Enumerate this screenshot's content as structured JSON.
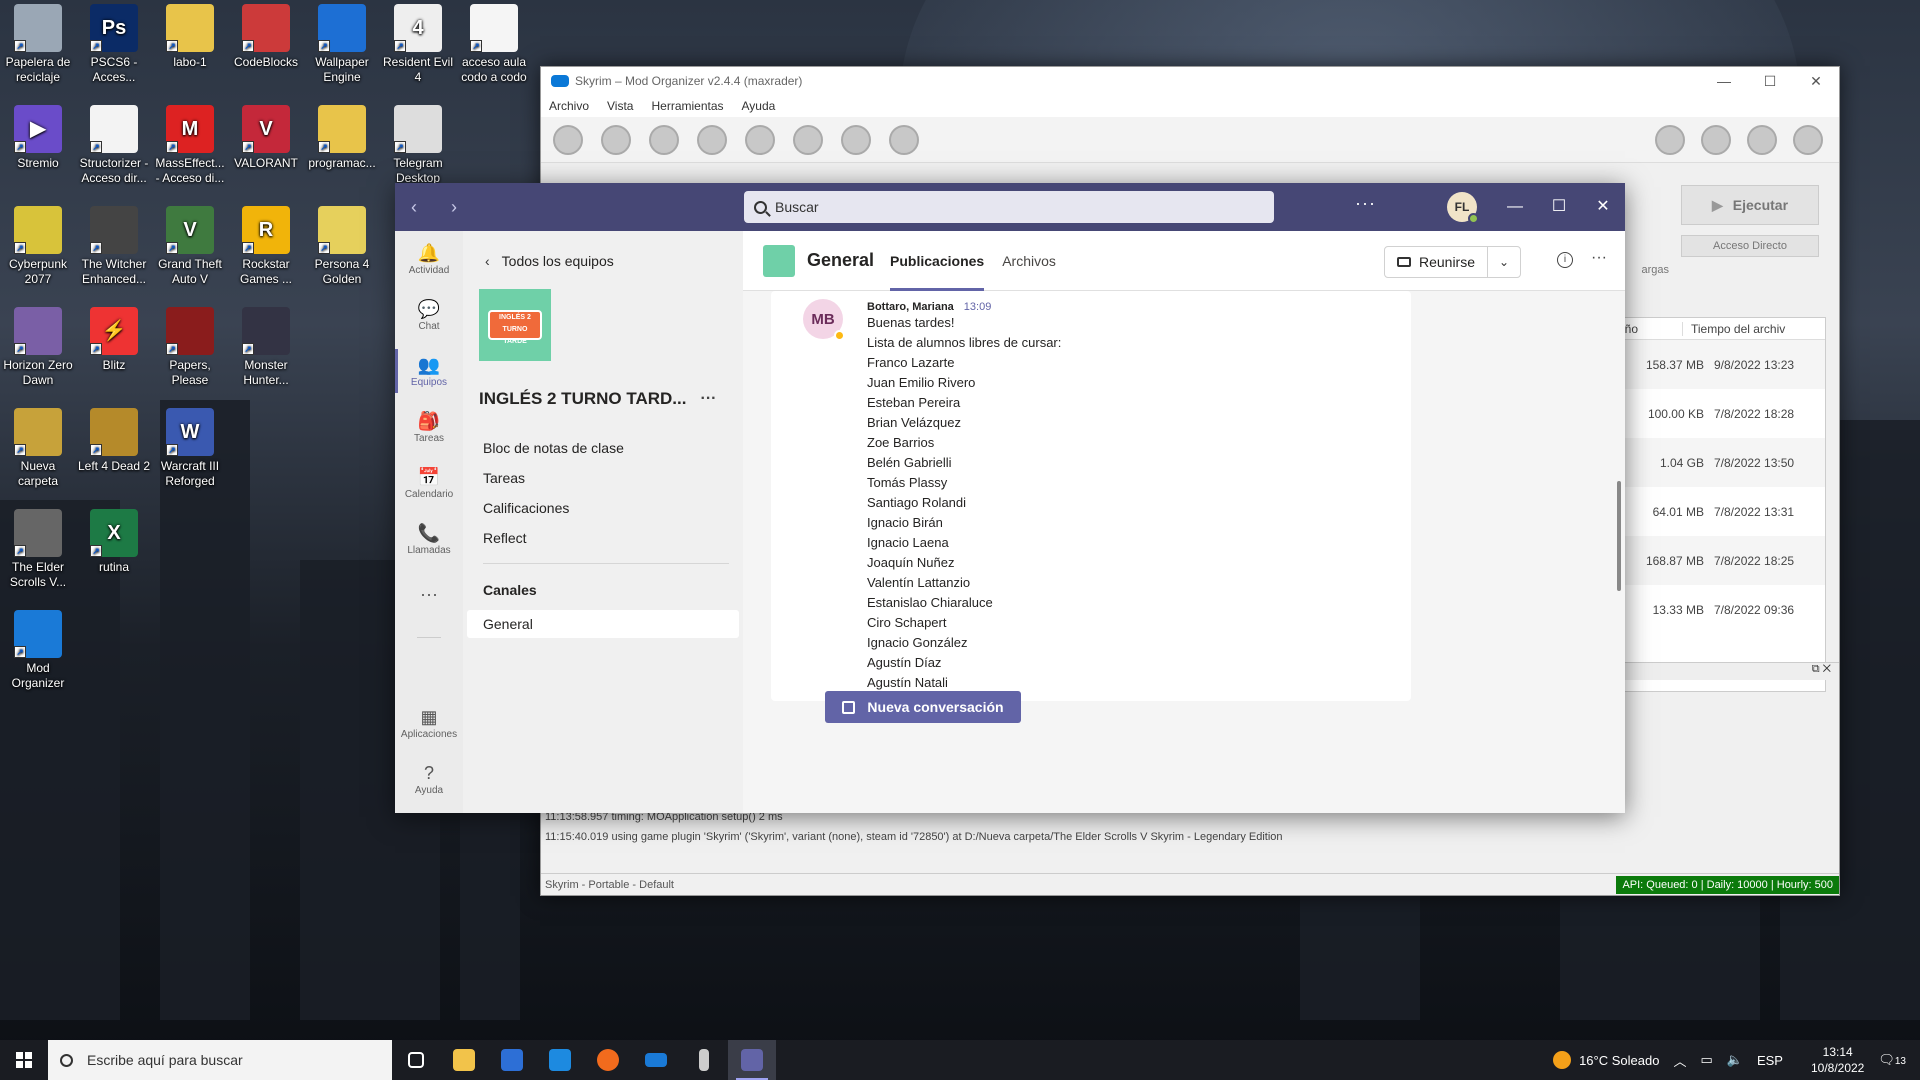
{
  "desktop": {
    "icons": [
      {
        "label": "Papelera de reciclaje",
        "color": "#9aa7b5",
        "glyph": ""
      },
      {
        "label": "PSCS6 - Acces...",
        "color": "#0b2b66",
        "glyph": "Ps"
      },
      {
        "label": "labo-1",
        "color": "#e8c44a",
        "glyph": ""
      },
      {
        "label": "CodeBlocks",
        "color": "#cc3a3a",
        "glyph": ""
      },
      {
        "label": "Wallpaper Engine",
        "color": "#1d6fd4",
        "glyph": ""
      },
      {
        "label": "Resident Evil 4",
        "color": "#eeeeee",
        "glyph": "4"
      },
      {
        "label": "acceso aula codo a codo",
        "color": "#f5f5f5",
        "glyph": ""
      },
      {
        "label": "Stremio",
        "color": "#6a4cc9",
        "glyph": "▶"
      },
      {
        "label": "Structorizer - Acceso dir...",
        "color": "#f3f3f3",
        "glyph": ""
      },
      {
        "label": "MassEffect... - Acceso di...",
        "color": "#d22",
        "glyph": "M"
      },
      {
        "label": "VALORANT",
        "color": "#c4283a",
        "glyph": "V"
      },
      {
        "label": "programac...",
        "color": "#e8c44a",
        "glyph": ""
      },
      {
        "label": "Telegram Desktop",
        "color": "#ddd",
        "glyph": ""
      },
      {
        "label": "Cyberpunk 2077",
        "color": "#d8c33a",
        "glyph": ""
      },
      {
        "label": "The Witcher Enhanced...",
        "color": "#444",
        "glyph": ""
      },
      {
        "label": "Grand Theft Auto V",
        "color": "#3f7a3f",
        "glyph": "V"
      },
      {
        "label": "Rockstar Games ...",
        "color": "#f1b40a",
        "glyph": "R"
      },
      {
        "label": "Persona 4 Golden",
        "color": "#e6d05c",
        "glyph": ""
      },
      {
        "label": "Horizon Zero Dawn",
        "color": "#7a5fa6",
        "glyph": ""
      },
      {
        "label": "Blitz",
        "color": "#e33",
        "glyph": "⚡"
      },
      {
        "label": "Papers, Please",
        "color": "#8a1c1c",
        "glyph": ""
      },
      {
        "label": "Monster Hunter...",
        "color": "#334",
        "glyph": ""
      },
      {
        "label": "Nueva carpeta",
        "color": "#c7a23a",
        "glyph": ""
      },
      {
        "label": "Left 4 Dead 2",
        "color": "#b58a2a",
        "glyph": ""
      },
      {
        "label": "Warcraft III Reforged",
        "color": "#3a59b0",
        "glyph": "W"
      },
      {
        "label": "The Elder Scrolls V...",
        "color": "#666",
        "glyph": ""
      },
      {
        "label": "rutina",
        "color": "#1d7a45",
        "glyph": "X"
      },
      {
        "label": "Mod Organizer",
        "color": "#1a7ad7",
        "glyph": ""
      }
    ]
  },
  "mo": {
    "title": "Skyrim – Mod Organizer v2.4.4 (maxrader)",
    "menu": [
      "Archivo",
      "Vista",
      "Herramientas",
      "Ayuda"
    ],
    "run_label": "Ejecutar",
    "access_label": "Acceso Directo",
    "tab_label": "argas",
    "col_size": "año",
    "col_time": "Tiempo del archiv",
    "rows": [
      {
        "size": "158.37 MB",
        "date": "9/8/2022 13:23"
      },
      {
        "size": "100.00 KB",
        "date": "7/8/2022 18:28"
      },
      {
        "size": "1.04 GB",
        "date": "7/8/2022 13:50"
      },
      {
        "size": "64.01 MB",
        "date": "7/8/2022 13:31"
      },
      {
        "size": "168.87 MB",
        "date": "7/8/2022 18:25"
      },
      {
        "size": "13.33 MB",
        "date": "7/8/2022 09:36"
      }
    ],
    "log": [
      "11:13:58.957  timing: MOApplication setup() 2 ms",
      "11:15:40.019  using game plugin 'Skyrim' ('Skyrim', variant (none), steam id '72850') at D:/Nueva carpeta/The Elder Scrolls V Skyrim - Legendary Edition"
    ],
    "status": "Skyrim - Portable - Default",
    "api": "API: Queued: 0 | Daily: 10000 | Hourly: 500"
  },
  "teams": {
    "search_placeholder": "Buscar",
    "avatar": "FL",
    "rail": [
      {
        "label": "Actividad",
        "icon": "🔔"
      },
      {
        "label": "Chat",
        "icon": "💬"
      },
      {
        "label": "Equipos",
        "icon": "👥"
      },
      {
        "label": "Tareas",
        "icon": "🎒"
      },
      {
        "label": "Calendario",
        "icon": "📅"
      },
      {
        "label": "Llamadas",
        "icon": "📞"
      }
    ],
    "rail_bottom": [
      {
        "label": "Aplicaciones",
        "icon": "▦"
      },
      {
        "label": "Ayuda",
        "icon": "?"
      }
    ],
    "back_label": "Todos los equipos",
    "team_name": "INGLÉS 2 TURNO TARD...",
    "team_img_text": "INGLÉS 2 TURNO TARDE",
    "links": [
      "Bloc de notas de clase",
      "Tareas",
      "Calificaciones",
      "Reflect"
    ],
    "channels_header": "Canales",
    "channel": "General",
    "channel_title": "General",
    "tabs": [
      "Publicaciones",
      "Archivos"
    ],
    "meet_label": "Reunirse",
    "message": {
      "avatar": "MB",
      "author": "Bottaro, Mariana",
      "time": "13:09",
      "lines": [
        "Buenas tardes!",
        "Lista de alumnos libres de cursar:",
        "Franco Lazarte",
        "Juan Emilio Rivero",
        "Esteban Pereira",
        "Brian Velázquez",
        "Zoe Barrios",
        "Belén Gabrielli",
        "Tomás Plassy",
        "Santiago Rolandi",
        "Ignacio Birán",
        "Ignacio Laena",
        "Joaquín Nuñez",
        "Valentín Lattanzio",
        "Estanislao Chiaraluce",
        "Ciro Schapert",
        "Ignacio González",
        "Agustín Díaz",
        "Agustín Natali"
      ]
    },
    "new_conversation": "Nueva conversación"
  },
  "taskbar": {
    "search_placeholder": "Escribe aquí para buscar",
    "weather": "16°C  Soleado",
    "lang": "ESP",
    "time": "13:14",
    "date": "10/8/2022",
    "notif_count": "13"
  }
}
